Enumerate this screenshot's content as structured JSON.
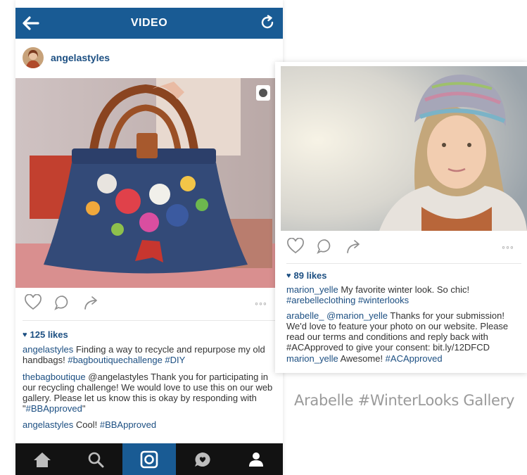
{
  "left_post": {
    "header_title": "VIDEO",
    "username": "angelastyles",
    "likes": "125 likes",
    "dots": "◦◦◦",
    "comments": [
      {
        "user": "angelastyles",
        "text": " Finding a way to recycle and repurpose my old handbags! ",
        "tags": "#bagboutiquechallenge #DIY"
      },
      {
        "user": "thebagboutique",
        "text": " @angelastyles Thank you for participating in our recycling challenge!  We would love to use this on our web gallery. Please let us know this is okay by responding with \"",
        "tags": "#BBApproved",
        "tail": "\""
      },
      {
        "user": "angelastyles",
        "text": " Cool! ",
        "tags": "#BBApproved"
      }
    ]
  },
  "right_post": {
    "likes": "89 likes",
    "dots": "◦◦◦",
    "comments": [
      {
        "user": "marion_yelle",
        "text": " My favorite winter look. So chic! ",
        "tags": "#arebelleclothing #winterlooks"
      },
      {
        "user": "arabelle_",
        "mention": " @marion_yelle",
        "text": " Thanks for your submission! We'd love to feature your photo on our website. Please read our terms and conditions and reply back with #ACApproved to give your consent: bit.ly/12DFCD"
      },
      {
        "user": "marion_yelle",
        "text": " Awesome! ",
        "tags": "#ACApproved"
      }
    ]
  },
  "caption": "Arabelle #WinterLooks Gallery",
  "icons": {
    "back": "back-arrow-icon",
    "refresh": "refresh-icon",
    "like": "heart-outline-icon",
    "comment": "comment-bubble-icon",
    "share": "share-arrow-icon",
    "video": "video-camera-icon",
    "nav": [
      "home-icon",
      "search-icon",
      "camera-icon",
      "activity-icon",
      "profile-icon"
    ]
  },
  "colors": {
    "brand_blue": "#195b94",
    "link_blue": "#1c4f82",
    "nav_bg": "#121212"
  }
}
